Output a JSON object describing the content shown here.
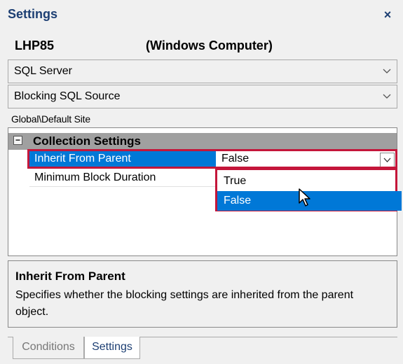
{
  "panel": {
    "title": "Settings",
    "close_label": "×"
  },
  "server": {
    "name": "LHP85",
    "type": "(Windows Computer)"
  },
  "combos": [
    {
      "value": "SQL Server"
    },
    {
      "value": "Blocking SQL Source"
    }
  ],
  "scope_path": "Global\\Default Site",
  "property_grid": {
    "category": {
      "toggle": "−",
      "label": "Collection Settings"
    },
    "rows": [
      {
        "name": "Inherit From Parent",
        "value": "False",
        "selected": true
      },
      {
        "name": "Minimum Block Duration",
        "value": ""
      }
    ],
    "dropdown_options": [
      "True",
      "False"
    ],
    "highlighted_option": "False"
  },
  "description": {
    "title": "Inherit From Parent",
    "text": "Specifies whether the blocking settings are inherited from the parent object."
  },
  "tabs": [
    {
      "label": "Conditions",
      "active": false
    },
    {
      "label": "Settings",
      "active": true
    }
  ],
  "colors": {
    "selection": "#0078d7",
    "highlight_border": "#c4163a",
    "title": "#1d3f73"
  }
}
